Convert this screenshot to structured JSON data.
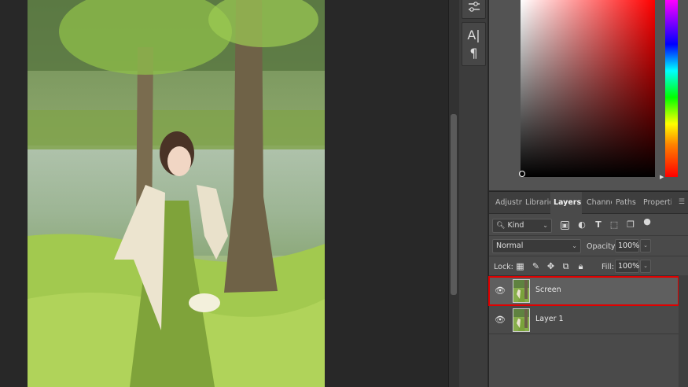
{
  "tools": {
    "adjust_icon": "sliders-icon",
    "type_icon_label": "A|",
    "paragraph_icon_label": "¶"
  },
  "color_picker": {
    "hue_color": "#ff0000"
  },
  "layers_panel": {
    "tabs": [
      {
        "label": "Adjustments",
        "active": false
      },
      {
        "label": "Libraries",
        "active": false
      },
      {
        "label": "Layers",
        "active": true
      },
      {
        "label": "Channels",
        "active": false
      },
      {
        "label": "Paths",
        "active": false
      },
      {
        "label": "Properties",
        "active": false
      }
    ],
    "filter": {
      "kind_label": "Kind"
    },
    "blend_mode": "Normal",
    "opacity_label": "Opacity:",
    "opacity_value": "100%",
    "lock_label": "Lock:",
    "fill_label": "Fill:",
    "fill_value": "100%",
    "layers": [
      {
        "name": "Screen",
        "selected": true,
        "visible": true
      },
      {
        "name": "Layer 1",
        "selected": false,
        "visible": true
      }
    ]
  },
  "colors": {
    "highlight": "#e00000",
    "panel_bg": "#4a4a4a",
    "canvas_bg": "#282828"
  }
}
